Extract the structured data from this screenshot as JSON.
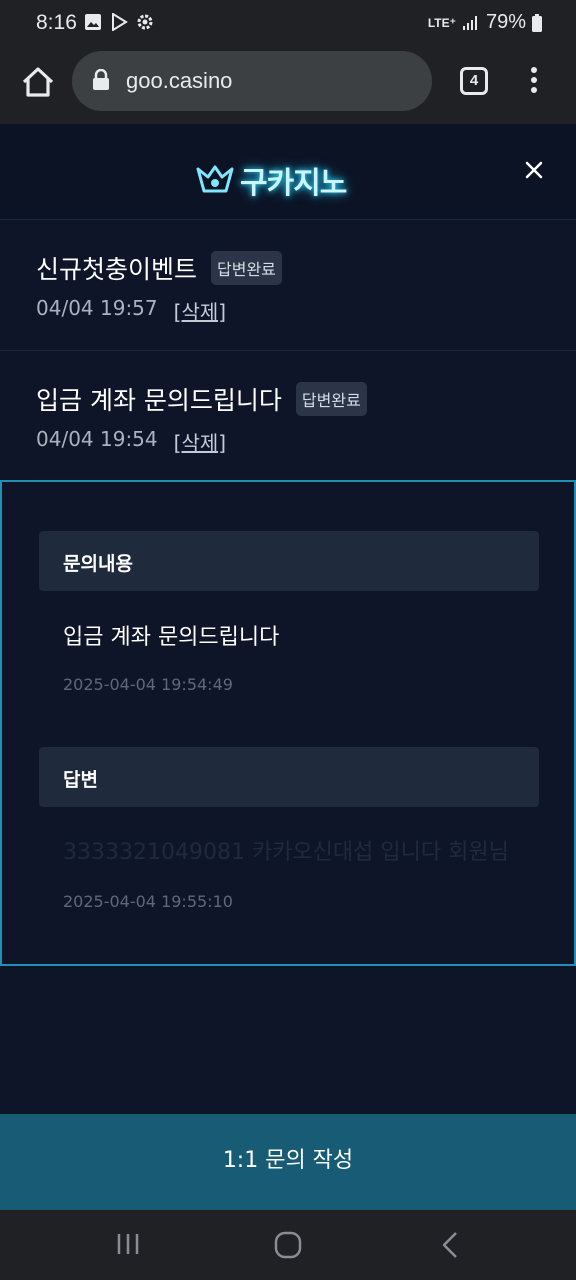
{
  "status_bar": {
    "time": "8:16",
    "network": "LTE⁺",
    "battery": "79%"
  },
  "browser": {
    "url": "goo.casino",
    "tab_count": "4"
  },
  "site": {
    "logo_text": "구카지노"
  },
  "inquiries": [
    {
      "title": "신규첫충이벤트",
      "badge": "답변완료",
      "date": "04/04 19:57",
      "delete_label": "[삭제]"
    },
    {
      "title": "입금 계좌 문의드립니다",
      "badge": "답변완료",
      "date": "04/04 19:54",
      "delete_label": "[삭제]"
    }
  ],
  "detail": {
    "content_heading": "문의내용",
    "content_text": "입금 계좌 문의드립니다",
    "content_timestamp": "2025-04-04 19:54:49",
    "answer_heading": "답변",
    "answer_text": "3333321049081 카카오신대섭 입니다 회원님",
    "answer_timestamp": "2025-04-04 19:55:10"
  },
  "write_button": "1:1 문의 작성",
  "colors": {
    "accent_border": "#1f8fb3",
    "button_bg": "#185b75",
    "page_bg": "#0e1528"
  }
}
